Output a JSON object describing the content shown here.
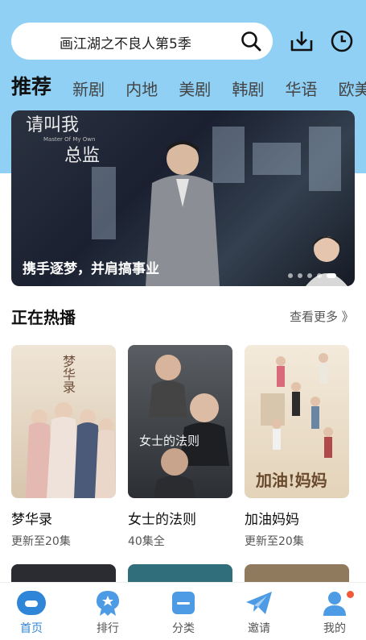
{
  "search": {
    "text": "画江湖之不良人第5季"
  },
  "tabs": [
    {
      "label": "推荐",
      "active": true
    },
    {
      "label": "新剧"
    },
    {
      "label": "内地"
    },
    {
      "label": "美剧"
    },
    {
      "label": "韩剧"
    },
    {
      "label": "华语"
    },
    {
      "label": "欧美"
    }
  ],
  "banner": {
    "title_line1": "请叫我",
    "title_line2": "总监",
    "subtitle_en": "Master Of My Own",
    "caption": "携手逐梦，并肩搞事业",
    "dots": 5,
    "active_dot": 4
  },
  "section": {
    "title": "正在热播",
    "more": "查看更多 》"
  },
  "cards": [
    {
      "title": "梦华录",
      "sub": "更新至20集",
      "poster_text": "梦华录",
      "color": "#e9dccb"
    },
    {
      "title": "女士的法则",
      "sub": "40集全",
      "poster_text": "女士的法则",
      "color": "#3e4247"
    },
    {
      "title": "加油妈妈",
      "sub": "更新至20集",
      "poster_text": "加油!妈妈",
      "color": "#eadfca"
    }
  ],
  "bottom_nav": [
    {
      "label": "首页",
      "icon": "home-icon",
      "active": true
    },
    {
      "label": "排行",
      "icon": "ranking-icon"
    },
    {
      "label": "分类",
      "icon": "category-icon"
    },
    {
      "label": "邀请",
      "icon": "invite-icon"
    },
    {
      "label": "我的",
      "icon": "profile-icon",
      "badge": true
    }
  ],
  "colors": {
    "accent": "#2f86d8",
    "header_bg": "#8fd0f4",
    "badge": "#f05a3a"
  }
}
